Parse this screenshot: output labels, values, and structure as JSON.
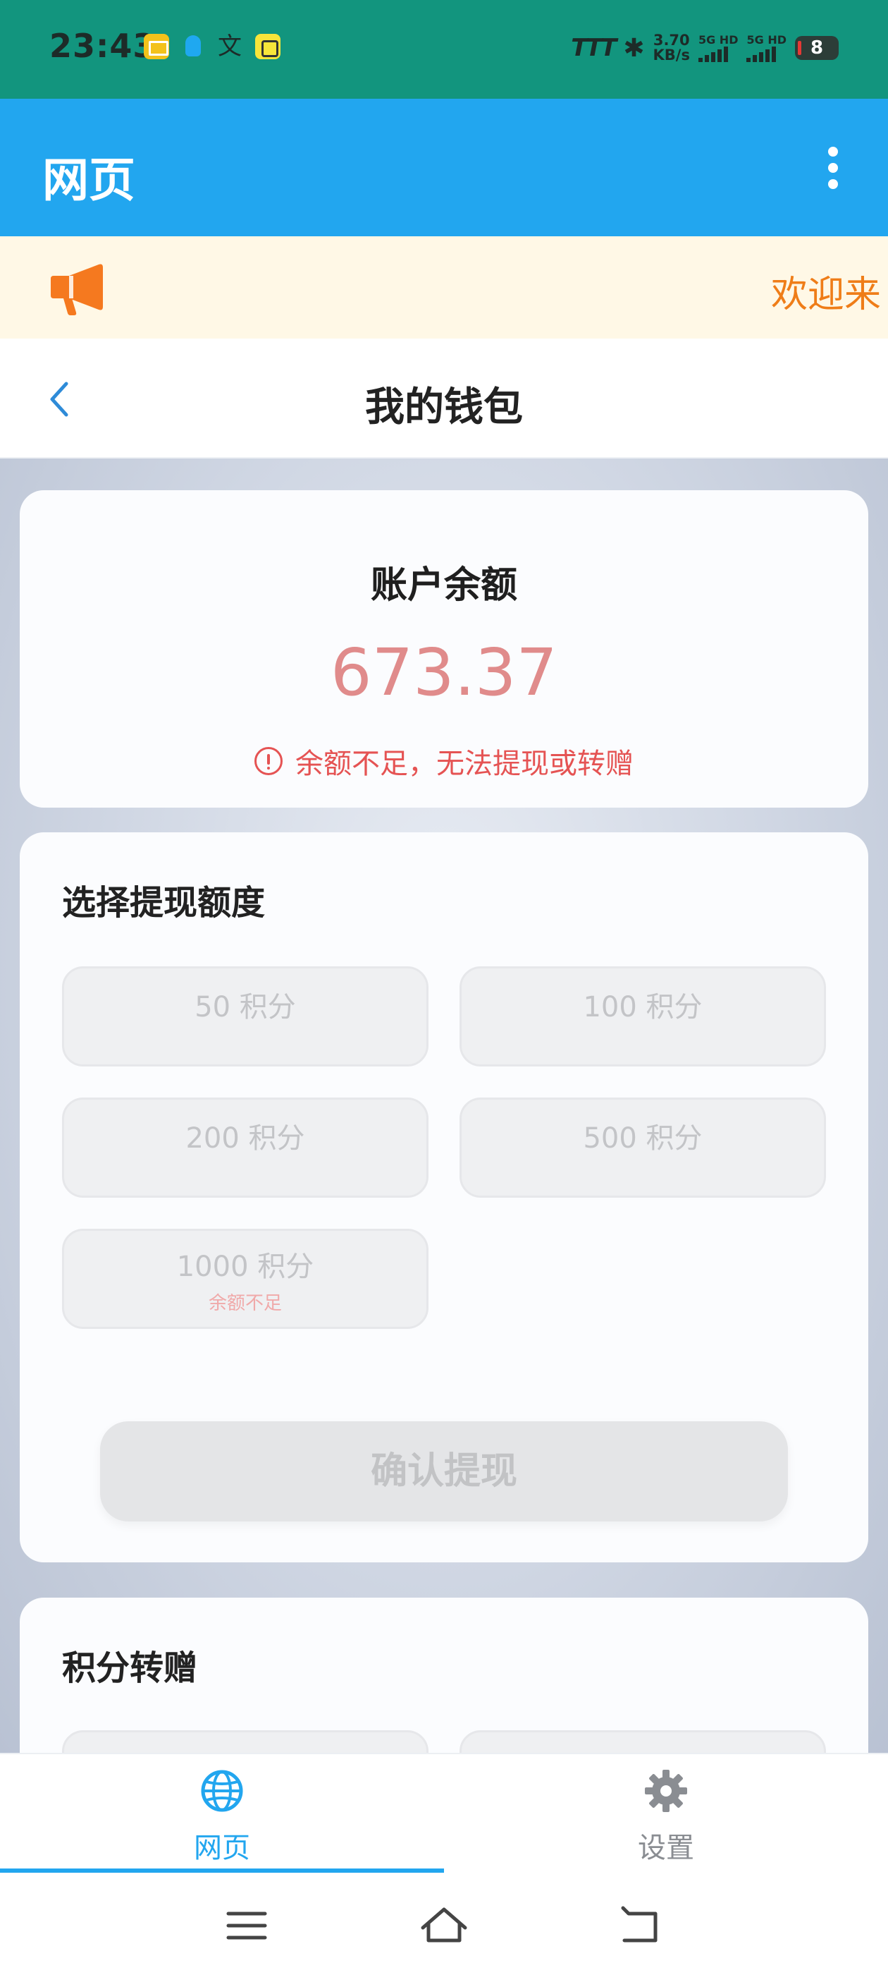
{
  "status_bar": {
    "time": "23:43",
    "carrier_logo": "TTT",
    "net_speed_value": "3.70",
    "net_speed_unit": "KB/s",
    "sim1_label": "5G HD",
    "sim2_label": "5G HD",
    "battery": "8",
    "icons": [
      "mail-notification-icon",
      "qq-icon",
      "translate-icon",
      "app-notification-icon",
      "bluetooth-icon",
      "signal-icon",
      "battery-icon"
    ]
  },
  "app_bar": {
    "title": "网页",
    "menu_icon": "more-vertical-icon"
  },
  "notice": {
    "icon": "megaphone-icon",
    "text": "欢迎来"
  },
  "page_header": {
    "back_icon": "chevron-left-icon",
    "title": "我的钱包"
  },
  "balance_card": {
    "title": "账户余额",
    "amount": "673.37",
    "warning": "余额不足，无法提现或转赠"
  },
  "withdraw_card": {
    "title": "选择提现额度",
    "options": [
      {
        "label": "50 积分",
        "note": ""
      },
      {
        "label": "100 积分",
        "note": ""
      },
      {
        "label": "200 积分",
        "note": ""
      },
      {
        "label": "500 积分",
        "note": ""
      },
      {
        "label": "1000 积分",
        "note": "余额不足"
      }
    ],
    "confirm_label": "确认提现"
  },
  "transfer_card": {
    "title": "积分转赠"
  },
  "bottom_nav": {
    "items": [
      {
        "label": "网页",
        "icon": "globe-icon",
        "active": true
      },
      {
        "label": "设置",
        "icon": "gear-icon",
        "active": false
      }
    ]
  },
  "colors": {
    "status_bar": "#12957e",
    "app_bar": "#22a6ef",
    "accent": "#22a6ef",
    "notice_bg": "#fff8e6",
    "notice_text": "#ef7d18",
    "amount": "#e08b8b",
    "warning": "#e55353"
  }
}
